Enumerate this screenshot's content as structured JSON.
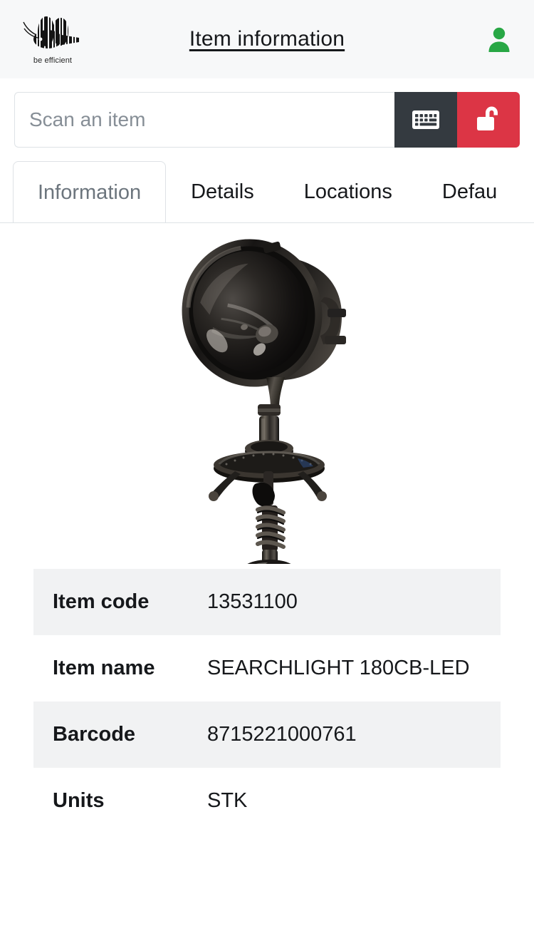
{
  "header": {
    "logo_tagline": "be efficient",
    "logo_name": "bee-barcode-logo",
    "title": "Item information",
    "account_icon": "person-icon"
  },
  "search": {
    "placeholder": "Scan an item",
    "value": "",
    "keyboard_icon": "keyboard-icon",
    "unlock_icon": "unlock-padlock-icon",
    "keyboard_button_color": "#343a40",
    "unlock_button_color": "#dc3545"
  },
  "tabs": [
    {
      "label": "Information",
      "active": true
    },
    {
      "label": "Details",
      "active": false
    },
    {
      "label": "Locations",
      "active": false
    },
    {
      "label": "Defau",
      "active": false
    }
  ],
  "product": {
    "image_alt": "searchlight-product-photo"
  },
  "details": {
    "rows": [
      {
        "label": "Item code",
        "value": "13531100"
      },
      {
        "label": "Item name",
        "value": "SEARCHLIGHT 180CB-LED"
      },
      {
        "label": "Barcode",
        "value": "8715221000761"
      },
      {
        "label": "Units",
        "value": "STK"
      }
    ]
  },
  "colors": {
    "header_bg": "#f7f8f9",
    "accent_green": "#28a745",
    "danger_red": "#dc3545",
    "dark": "#343a40",
    "stripe": "#f1f2f3"
  }
}
